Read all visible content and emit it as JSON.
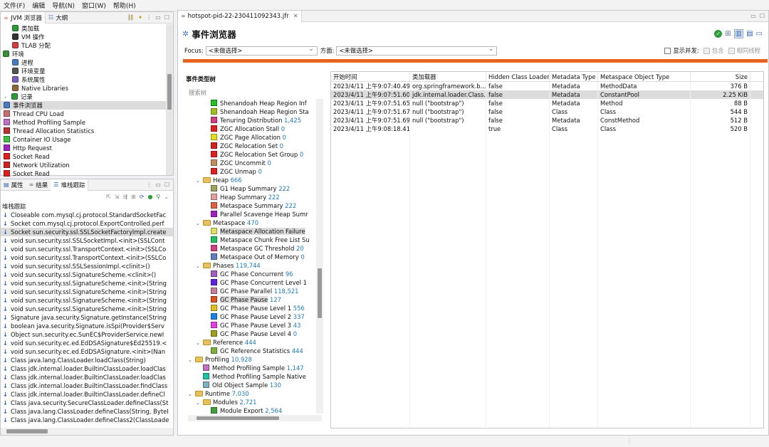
{
  "menu": [
    "文件(F)",
    "编辑",
    "导航(N)",
    "窗口(W)",
    "帮助(H)"
  ],
  "left_top": {
    "tabs": [
      "JVM 浏览器",
      "大纲"
    ],
    "items": [
      {
        "label": "类加载",
        "indent": 1,
        "icon": "gear-green-icon",
        "color": "#2e9b3a"
      },
      {
        "label": "VM 操作",
        "indent": 1,
        "icon": "vm-icon",
        "color": "#333333"
      },
      {
        "label": "TLAB 分配",
        "indent": 1,
        "icon": "tlab-icon",
        "color": "#d04040"
      },
      {
        "label": "环境",
        "indent": 0,
        "caret": "v",
        "icon": "env-icon",
        "color": "#3a8f3a"
      },
      {
        "label": "进程",
        "indent": 1,
        "icon": "process-icon",
        "color": "#4a7ac0"
      },
      {
        "label": "环境变量",
        "indent": 1,
        "icon": "envvar-icon",
        "color": "#555555"
      },
      {
        "label": "系统属性",
        "indent": 1,
        "icon": "sysprop-icon",
        "color": "#7a5fc0"
      },
      {
        "label": "Native Libraries",
        "indent": 1,
        "icon": "library-icon",
        "color": "#8a6a3a"
      },
      {
        "label": "记录",
        "indent": 1,
        "caret": ">",
        "icon": "record-icon",
        "color": "#2e9b3a"
      },
      {
        "label": "事件浏览器",
        "indent": 0,
        "icon": "event-browser-icon",
        "color": "#4a7ac0",
        "selected": true
      },
      {
        "label": "Thread CPU Load",
        "indent": 0,
        "color": "#c87070"
      },
      {
        "label": "Method Profiling Sample",
        "indent": 0,
        "color": "#c070c0"
      },
      {
        "label": "Thread Allocation Statistics",
        "indent": 0,
        "color": "#c03030"
      },
      {
        "label": "Container IO Usage",
        "indent": 0,
        "color": "#40c040"
      },
      {
        "label": "Http Request",
        "indent": 0,
        "color": "#a020c0"
      },
      {
        "label": "Socket Read",
        "indent": 0,
        "color": "#e02020"
      },
      {
        "label": "Network Utilization",
        "indent": 0,
        "color": "#d02020"
      },
      {
        "label": "Socket Read",
        "indent": 0,
        "color": "#e02020"
      }
    ]
  },
  "left_bottom": {
    "tabs": [
      "属性",
      "结果",
      "堆栈跟踪"
    ],
    "header": "堆栈跟踪",
    "frames": [
      "Closeable com.mysql.cj.protocol.StandardSocketFac",
      "Socket com.mysql.cj.protocol.ExportControlled.perf",
      "Socket sun.security.ssl.SSLSocketFactoryImpl.create",
      "void sun.security.ssl.SSLSocketImpl.<init>(SSLCont",
      "void sun.security.ssl.TransportContext.<init>(SSLCo",
      "void sun.security.ssl.TransportContext.<init>(SSLCo",
      "void sun.security.ssl.SSLSessionImpl.<clinit>()",
      "void sun.security.ssl.SignatureScheme.<clinit>()",
      "void sun.security.ssl.SignatureScheme.<init>(String",
      "void sun.security.ssl.SignatureScheme.<init>(String",
      "void sun.security.ssl.SignatureScheme.<init>(String",
      "void sun.security.ssl.SignatureScheme.<init>(String",
      "Signature java.security.Signature.getInstance(String",
      "boolean java.security.Signature.isSpi(Provider$Serv",
      "Object sun.security.ec.SunEC$ProviderService.newI",
      "void sun.security.ec.ed.EdDSASignature$Ed25519.<",
      "void sun.security.ec.ed.EdDSASignature.<init>(Nan",
      "Class java.lang.ClassLoader.loadClass(String)",
      "Class jdk.internal.loader.BuiltinClassLoader.loadClas",
      "Class jdk.internal.loader.BuiltinClassLoader.loadClas",
      "Class jdk.internal.loader.BuiltinClassLoader.findClass",
      "Class jdk.internal.loader.BuiltinClassLoader.defineCl",
      "Class java.security.SecureClassLoader.defineClass(St",
      "Class java.lang.ClassLoader.defineClass(String, ByteI",
      "Class java.lang.ClassLoader.defineClass2(ClassLoade"
    ],
    "selected_index": 2
  },
  "editor": {
    "tab_title": "hotspot-pid-22-230411092343.jfr",
    "page_title": "事件浏览器",
    "focus_label": "Focus:",
    "focus_value": "<未做选择>",
    "aspect_label": "方面:",
    "aspect_value": "<未做选择>",
    "show_concurrent": "显示并发:",
    "contains": "包含",
    "same_thread": "相同线程",
    "tree_header": "事件类型树",
    "tree_search_placeholder": "搜索树",
    "progress_color": "#e8641e"
  },
  "event_tree": [
    {
      "label": "Shenandoah Heap Region Inf",
      "count": "",
      "level": 3,
      "color": "#22c022"
    },
    {
      "label": "Shenandoah Heap Region Sta",
      "count": "",
      "level": 3,
      "color": "#a0c020"
    },
    {
      "label": "Tenuring Distribution",
      "count": "1,425",
      "level": 3,
      "color": "#d04080"
    },
    {
      "label": "ZGC Allocation Stall",
      "count": "0",
      "level": 3,
      "color": "#e02020"
    },
    {
      "label": "ZGC Page Allocation",
      "count": "0",
      "level": 3,
      "color": "#e0e020"
    },
    {
      "label": "ZGC Relocation Set",
      "count": "0",
      "level": 3,
      "color": "#d02020"
    },
    {
      "label": "ZGC Relocation Set Group",
      "count": "0",
      "level": 3,
      "color": "#e02020"
    },
    {
      "label": "ZGC Uncommit",
      "count": "0",
      "level": 3,
      "color": "#c09060"
    },
    {
      "label": "ZGC Unmap",
      "count": "0",
      "level": 3,
      "color": "#e02020"
    },
    {
      "label": "Heap",
      "count": "666",
      "level": 2,
      "folder": true
    },
    {
      "label": "G1 Heap Summary",
      "count": "222",
      "level": 3,
      "color": "#a0a060"
    },
    {
      "label": "Heap Summary",
      "count": "222",
      "level": 3,
      "color": "#e0a0a0"
    },
    {
      "label": "Metaspace Summary",
      "count": "222",
      "level": 3,
      "color": "#e06040"
    },
    {
      "label": "Parallel Scavenge Heap Sumr",
      "count": "",
      "level": 3,
      "color": "#a020c0"
    },
    {
      "label": "Metaspace",
      "count": "470",
      "level": 2,
      "folder": true
    },
    {
      "label": "Metaspace Allocation Failure",
      "count": "",
      "level": 3,
      "color": "#e0e060",
      "selected": true
    },
    {
      "label": "Metaspace Chunk Free List Su",
      "count": "",
      "level": 3,
      "color": "#20c060"
    },
    {
      "label": "Metaspace GC Threshold",
      "count": "20",
      "level": 3,
      "color": "#d04080"
    },
    {
      "label": "Metaspace Out of Memory",
      "count": "0",
      "level": 3,
      "color": "#6080c0"
    },
    {
      "label": "Phases",
      "count": "119,744",
      "level": 2,
      "folder": true
    },
    {
      "label": "GC Phase Concurrent",
      "count": "96",
      "level": 3,
      "color": "#a060c0"
    },
    {
      "label": "GC Phase Concurrent Level 1",
      "count": "",
      "level": 3,
      "color": "#6020e0"
    },
    {
      "label": "GC Phase Parallel",
      "count": "118,521",
      "level": 3,
      "color": "#c080a0"
    },
    {
      "label": "GC Phase Pause",
      "count": "127",
      "level": 3,
      "color": "#e05020",
      "selected": true
    },
    {
      "label": "GC Phase Pause Level 1",
      "count": "556",
      "level": 3,
      "color": "#e0c020"
    },
    {
      "label": "GC Phase Pause Level 2",
      "count": "337",
      "level": 3,
      "color": "#2080e0"
    },
    {
      "label": "GC Phase Pause Level 3",
      "count": "43",
      "level": 3,
      "color": "#e040e0"
    },
    {
      "label": "GC Phase Pause Level 4",
      "count": "0",
      "level": 3,
      "color": "#a0a020"
    },
    {
      "label": "Reference",
      "count": "444",
      "level": 2,
      "folder": true
    },
    {
      "label": "GC Reference Statistics",
      "count": "444",
      "level": 3,
      "color": "#80b040"
    },
    {
      "label": "Profiling",
      "count": "10,928",
      "level": 1,
      "folder": true
    },
    {
      "label": "Method Profiling Sample",
      "count": "1,147",
      "level": 2,
      "color": "#c070c0"
    },
    {
      "label": "Method Profiling Sample Native",
      "count": "",
      "level": 2,
      "color": "#20c0a0"
    },
    {
      "label": "Old Object Sample",
      "count": "130",
      "level": 2,
      "color": "#80b0c0"
    },
    {
      "label": "Runtime",
      "count": "7,030",
      "level": 1,
      "folder": true
    },
    {
      "label": "Modules",
      "count": "2,721",
      "level": 2,
      "folder": true
    },
    {
      "label": "Module Export",
      "count": "2,564",
      "level": 3,
      "color": "#40a040"
    }
  ],
  "table": {
    "columns": [
      "开始时间",
      "类加载器",
      "Hidden Class Loader",
      "Metadata Type",
      "Metaspace Object Type",
      "Size"
    ],
    "rows": [
      [
        "2023/4/11 上午9:07:40.497",
        "org.springframework.b...",
        "false",
        "Metadata",
        "MethodData",
        "376 B"
      ],
      [
        "2023/4/11 上午9:07:51.603",
        "jdk.internal.loader.Class...",
        "false",
        "Metadata",
        "ConstantPool",
        "2.25 KiB"
      ],
      [
        "2023/4/11 上午9:07:51.653",
        "null (\"bootstrap\")",
        "false",
        "Metadata",
        "Method",
        "88 B"
      ],
      [
        "2023/4/11 上午9:07:51.678",
        "null (\"bootstrap\")",
        "false",
        "Class",
        "Class",
        "544 B"
      ],
      [
        "2023/4/11 上午9:07:51.698",
        "null (\"bootstrap\")",
        "false",
        "Metadata",
        "ConstMethod",
        "512 B"
      ],
      [
        "2023/4/11 上午9:08:18.415",
        "",
        "true",
        "Class",
        "Class",
        "520 B"
      ]
    ],
    "selected_index": 1
  }
}
